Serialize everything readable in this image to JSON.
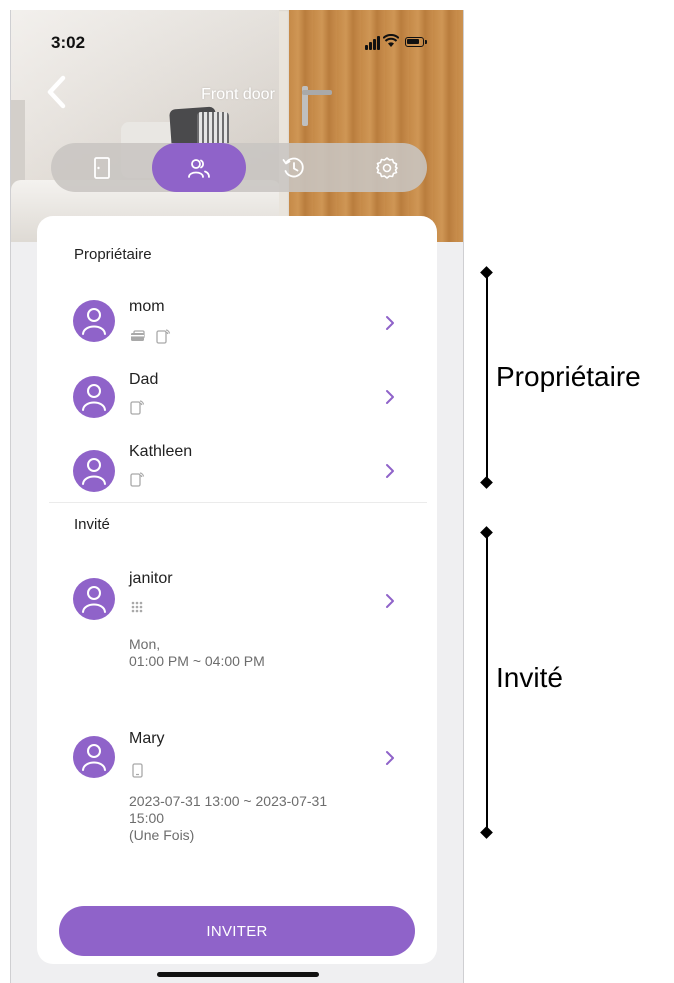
{
  "status_bar": {
    "time": "3:02"
  },
  "header": {
    "title": "Front door"
  },
  "tabs": [
    {
      "icon": "door-icon",
      "active": false
    },
    {
      "icon": "users-icon",
      "active": true
    },
    {
      "icon": "history-icon",
      "active": false
    },
    {
      "icon": "gear-icon",
      "active": false
    }
  ],
  "owners": {
    "title": "Propriétaire",
    "items": [
      {
        "name": "mom",
        "credentials": [
          "card-icon",
          "phone-nfc-icon"
        ]
      },
      {
        "name": "Dad",
        "credentials": [
          "phone-nfc-icon"
        ]
      },
      {
        "name": "Kathleen",
        "credentials": [
          "phone-nfc-icon"
        ]
      }
    ]
  },
  "guests": {
    "title": "Invité",
    "items": [
      {
        "name": "janitor",
        "credentials": [
          "keypad-icon"
        ],
        "schedule": "Mon,\n01:00 PM ~ 04:00 PM"
      },
      {
        "name": "Mary",
        "credentials": [
          "phone-icon"
        ],
        "schedule": "2023-07-31 13:00 ~ 2023-07-31\n15:00\n (Une Fois)"
      }
    ]
  },
  "invite_button": {
    "label": "INVITER"
  },
  "annotations": {
    "owners_label": "Propriétaire",
    "guests_label": "Invité"
  },
  "colors": {
    "accent": "#8f63c9",
    "background": "#efeff1",
    "card": "#ffffff"
  }
}
